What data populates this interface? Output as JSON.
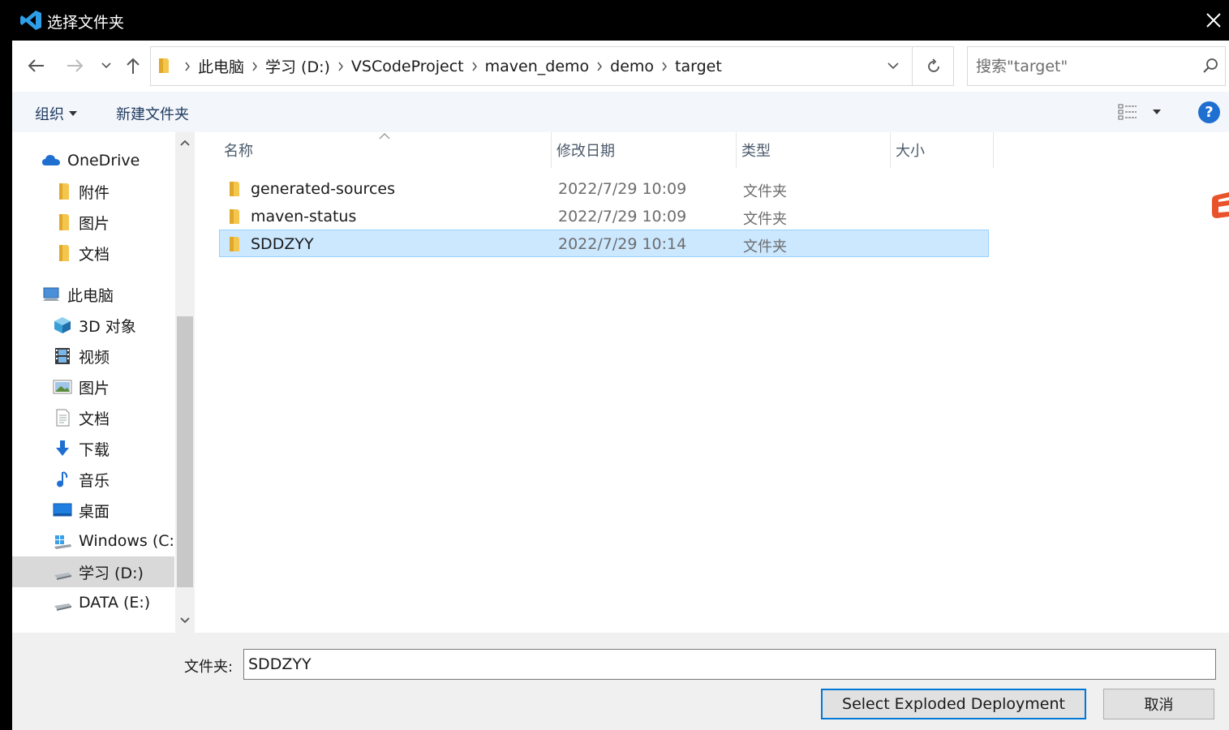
{
  "window": {
    "title": "选择文件夹",
    "app_icon": "vscode-icon",
    "close_icon": "close-icon"
  },
  "address": {
    "crumbs": [
      "此电脑",
      "学习 (D:)",
      "VSCodeProject",
      "maven_demo",
      "demo",
      "target"
    ],
    "search_placeholder": "搜索\"target\""
  },
  "toolbar": {
    "organize": "组织",
    "new_folder": "新建文件夹",
    "help": "?"
  },
  "nav": {
    "items": [
      {
        "label": "OneDrive",
        "icon": "cloud-icon",
        "indent": 0
      },
      {
        "label": "附件",
        "icon": "folder-icon",
        "indent": 1
      },
      {
        "label": "图片",
        "icon": "folder-icon",
        "indent": 1
      },
      {
        "label": "文档",
        "icon": "folder-icon",
        "indent": 1
      },
      {
        "label": "此电脑",
        "icon": "computer-icon",
        "indent": 0
      },
      {
        "label": "3D 对象",
        "icon": "3d-objects-icon",
        "indent": 1
      },
      {
        "label": "视频",
        "icon": "video-icon",
        "indent": 1
      },
      {
        "label": "图片",
        "icon": "pictures-icon",
        "indent": 1
      },
      {
        "label": "文档",
        "icon": "documents-icon",
        "indent": 1
      },
      {
        "label": "下载",
        "icon": "download-icon",
        "indent": 1
      },
      {
        "label": "音乐",
        "icon": "music-icon",
        "indent": 1
      },
      {
        "label": "桌面",
        "icon": "desktop-icon",
        "indent": 1
      },
      {
        "label": "Windows (C:)",
        "icon": "windows-drive-icon",
        "indent": 1
      },
      {
        "label": "学习 (D:)",
        "icon": "drive-icon",
        "indent": 1,
        "selected": true
      },
      {
        "label": "DATA (E:)",
        "icon": "drive-icon",
        "indent": 1
      }
    ]
  },
  "columns": {
    "name": "名称",
    "date": "修改日期",
    "type": "类型",
    "size": "大小"
  },
  "files": [
    {
      "name": "generated-sources",
      "date": "2022/7/29 10:09",
      "type": "文件夹"
    },
    {
      "name": "maven-status",
      "date": "2022/7/29 10:09",
      "type": "文件夹"
    },
    {
      "name": "SDDZYY",
      "date": "2022/7/29 10:14",
      "type": "文件夹",
      "selected": true
    }
  ],
  "bottom": {
    "folder_label": "文件夹:",
    "folder_value": "SDDZYY",
    "select_button": "Select Exploded Deployment",
    "cancel_button": "取消"
  },
  "colors": {
    "selection": "#cce8ff",
    "accent": "#0078d7",
    "folder": "#f4c64e"
  }
}
